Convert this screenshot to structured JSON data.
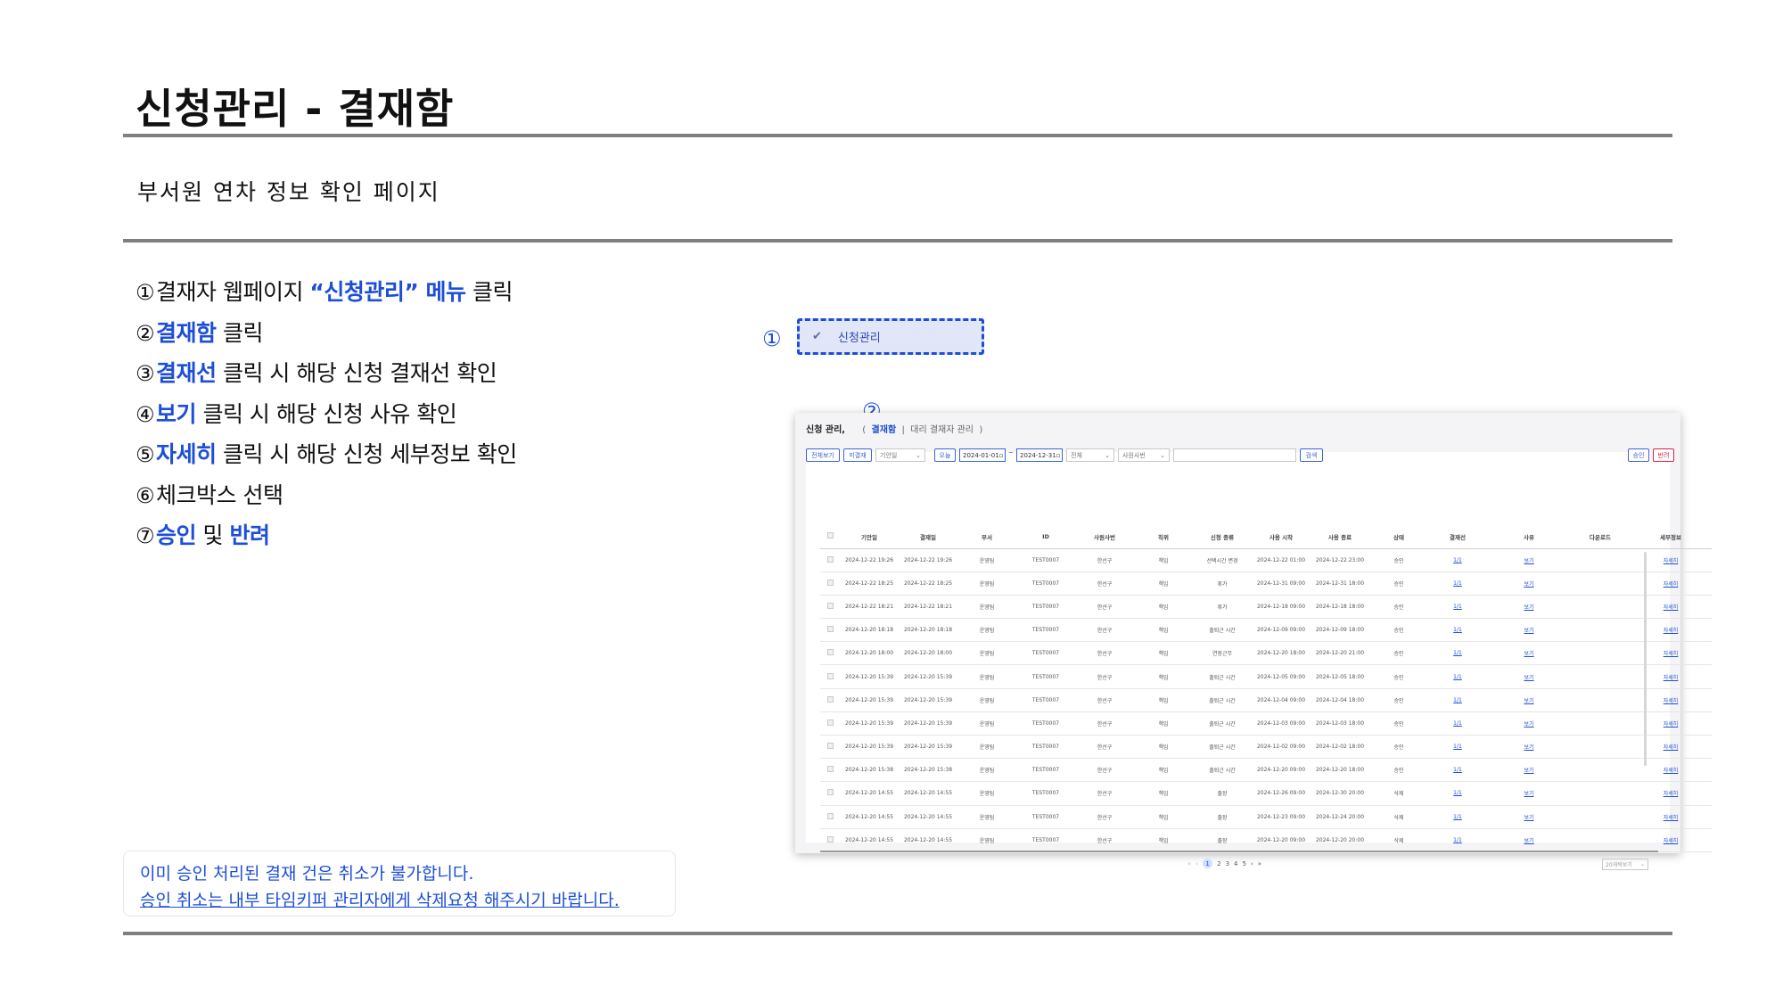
{
  "header": {
    "title": "신청관리 - 결재함",
    "subtitle": "부서원 연차 정보 확인 페이지"
  },
  "steps": [
    {
      "num": "①",
      "pre": "결재자 웹페이지 ",
      "hl": "“신청관리” 메뉴",
      "mid": " 클릭",
      "hl2": "",
      "post": ""
    },
    {
      "num": "②",
      "pre": "",
      "hl": "결재함",
      "mid": " 클릭",
      "hl2": "",
      "post": ""
    },
    {
      "num": "③",
      "pre": "",
      "hl": "결재선",
      "mid": " 클릭 시 해당 신청 결재선 확인",
      "hl2": "",
      "post": ""
    },
    {
      "num": "④",
      "pre": "",
      "hl": "보기",
      "mid": " 클릭 시 해당 신청 사유 확인",
      "hl2": "",
      "post": ""
    },
    {
      "num": "⑤",
      "pre": "",
      "hl": "자세히",
      "mid": " 클릭 시 해당 신청 세부정보 확인",
      "hl2": "",
      "post": ""
    },
    {
      "num": "⑥",
      "pre": "체크박스 선택",
      "hl": "",
      "mid": "",
      "hl2": "",
      "post": ""
    },
    {
      "num": "⑦",
      "pre": "",
      "hl": "승인",
      "mid": " 및 ",
      "hl2": "반려",
      "post": ""
    }
  ],
  "notice": {
    "line1": "이미 승인 처리된 결재 건은 취소가 불가합니다.",
    "line2": "승인 취소는 내부 타임키퍼 관리자에게 삭제요청 해주시기 바랍니다."
  },
  "markers": {
    "m1": "①",
    "m2": "②",
    "m3": "③",
    "m4": "④",
    "m5": "⑤",
    "m6": "⑥",
    "m7": "⑦"
  },
  "menu_highlight": {
    "icon": "check-icon",
    "glyph": "✔",
    "label": "신청관리"
  },
  "screenshot": {
    "title": "신청 관리,",
    "paren_open": "(",
    "tab_active": "결재함",
    "separator": "|",
    "tab_other": "대리 결재자 관리",
    "paren_close": ")",
    "filters": {
      "view_all": "전체보기",
      "pending": "미결재",
      "period_select": "기안일",
      "today": "오늘",
      "date_from": "2024-01-01",
      "date_to": "2024-12-31",
      "date_sep": "~",
      "type_select": "전체",
      "target_select": "사원사번",
      "search": "검색",
      "approve": "승인",
      "reject": "반려"
    },
    "columns": [
      "기안일",
      "결재일",
      "부서",
      "ID",
      "사원사번",
      "직위",
      "신청 종류",
      "사용 시작",
      "사용 종료",
      "상태",
      "결재선",
      "사유",
      "다운로드",
      "세부정보"
    ],
    "rows": [
      [
        "2024-12-22 19:26",
        "2024-12-22 19:26",
        "운영팀",
        "TEST0007",
        "한선구",
        "책임",
        "선택시간 변경",
        "2024-12-22 01:00",
        "2024-12-22 23:00",
        "승인",
        "1/1",
        "보기",
        "",
        "자세히"
      ],
      [
        "2024-12-22 18:25",
        "2024-12-22 18:25",
        "운영팀",
        "TEST0007",
        "한선구",
        "책임",
        "휴가",
        "2024-12-31 09:00",
        "2024-12-31 18:00",
        "승인",
        "1/1",
        "보기",
        "",
        "자세히"
      ],
      [
        "2024-12-22 18:21",
        "2024-12-22 18:21",
        "운영팀",
        "TEST0007",
        "한선구",
        "책임",
        "휴가",
        "2024-12-18 09:00",
        "2024-12-18 18:00",
        "승인",
        "1/1",
        "보기",
        "",
        "자세히"
      ],
      [
        "2024-12-20 18:18",
        "2024-12-20 18:18",
        "운영팀",
        "TEST0007",
        "한선구",
        "책임",
        "출퇴근 시간",
        "2024-12-09 09:00",
        "2024-12-09 18:00",
        "승인",
        "1/1",
        "보기",
        "",
        "자세히"
      ],
      [
        "2024-12-20 18:00",
        "2024-12-20 18:00",
        "운영팀",
        "TEST0007",
        "한선구",
        "책임",
        "연장근무",
        "2024-12-20 18:00",
        "2024-12-20 21:00",
        "승인",
        "1/1",
        "보기",
        "",
        "자세히"
      ],
      [
        "2024-12-20 15:39",
        "2024-12-20 15:39",
        "운영팀",
        "TEST0007",
        "한선구",
        "책임",
        "출퇴근 시간",
        "2024-12-05 09:00",
        "2024-12-05 18:00",
        "승인",
        "1/1",
        "보기",
        "",
        "자세히"
      ],
      [
        "2024-12-20 15:39",
        "2024-12-20 15:39",
        "운영팀",
        "TEST0007",
        "한선구",
        "책임",
        "출퇴근 시간",
        "2024-12-04 09:00",
        "2024-12-04 18:00",
        "승인",
        "1/1",
        "보기",
        "",
        "자세히"
      ],
      [
        "2024-12-20 15:39",
        "2024-12-20 15:39",
        "운영팀",
        "TEST0007",
        "한선구",
        "책임",
        "출퇴근 시간",
        "2024-12-03 09:00",
        "2024-12-03 18:00",
        "승인",
        "1/1",
        "보기",
        "",
        "자세히"
      ],
      [
        "2024-12-20 15:39",
        "2024-12-20 15:39",
        "운영팀",
        "TEST0007",
        "한선구",
        "책임",
        "출퇴근 시간",
        "2024-12-02 09:00",
        "2024-12-02 18:00",
        "승인",
        "1/1",
        "보기",
        "",
        "자세히"
      ],
      [
        "2024-12-20 15:38",
        "2024-12-20 15:38",
        "운영팀",
        "TEST0007",
        "한선구",
        "책임",
        "출퇴근 시간",
        "2024-12-20 09:00",
        "2024-12-20 18:00",
        "승인",
        "1/1",
        "보기",
        "",
        "자세히"
      ],
      [
        "2024-12-20 14:55",
        "2024-12-20 14:55",
        "운영팀",
        "TEST0007",
        "한선구",
        "책임",
        "출장",
        "2024-12-26 09:00",
        "2024-12-30 20:00",
        "삭제",
        "1/1",
        "보기",
        "",
        "자세히"
      ],
      [
        "2024-12-20 14:55",
        "2024-12-20 14:55",
        "운영팀",
        "TEST0007",
        "한선구",
        "책임",
        "출장",
        "2024-12-23 09:00",
        "2024-12-24 20:00",
        "삭제",
        "1/1",
        "보기",
        "",
        "자세히"
      ],
      [
        "2024-12-20 14:55",
        "2024-12-20 14:55",
        "운영팀",
        "TEST0007",
        "한선구",
        "책임",
        "출장",
        "2024-12-20 09:00",
        "2024-12-20 20:00",
        "삭제",
        "1/1",
        "보기",
        "",
        "자세히"
      ]
    ],
    "pager": {
      "first": "«",
      "prev": "‹",
      "pages": [
        "1",
        "2",
        "3",
        "4",
        "5"
      ],
      "next": "›",
      "last": "»",
      "page_size": "20개씩보기"
    }
  },
  "colors": {
    "accent": "#1d4ed8",
    "reject": "#e11d48",
    "rule": "#7f7f7f"
  }
}
